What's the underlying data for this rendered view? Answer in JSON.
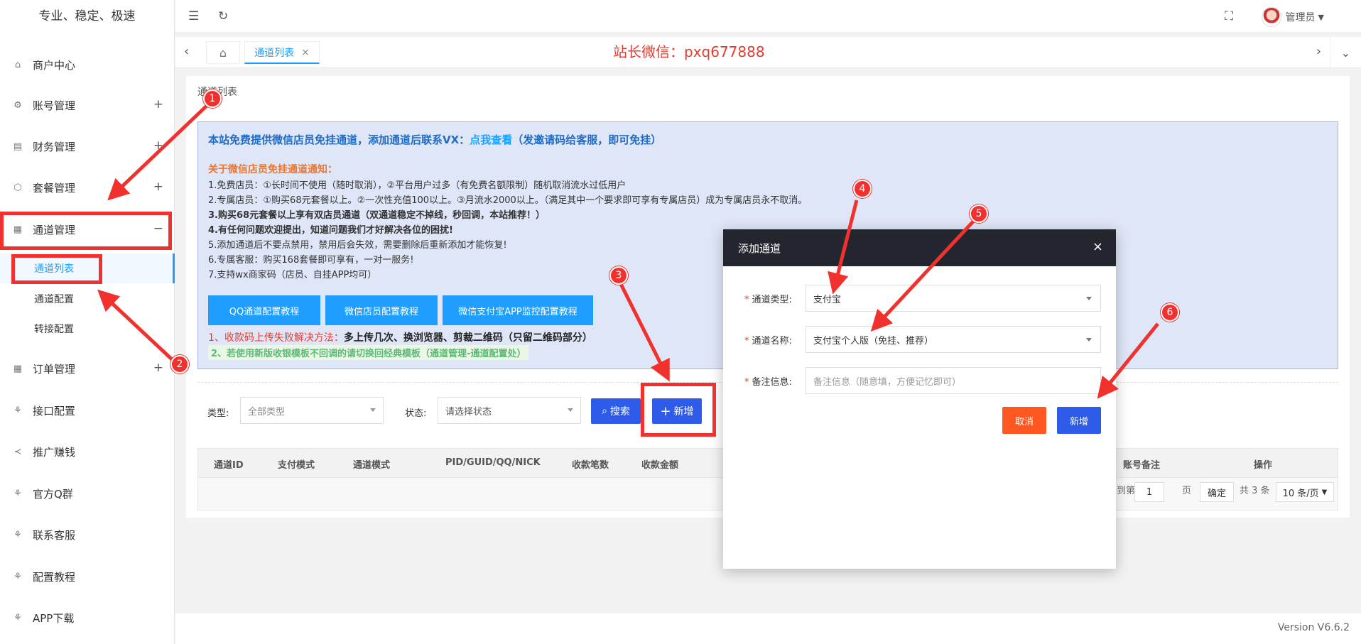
{
  "sidebar": {
    "brand": "专业、稳定、极速",
    "items": [
      {
        "label": "商户中心",
        "icon": "home-icon",
        "plus": ""
      },
      {
        "label": "账号管理",
        "icon": "gear-icon",
        "plus": "+"
      },
      {
        "label": "财务管理",
        "icon": "ledger-icon",
        "plus": "+"
      },
      {
        "label": "套餐管理",
        "icon": "package-icon",
        "plus": "+"
      },
      {
        "label": "通道管理",
        "icon": "apps-icon",
        "plus": "−"
      },
      {
        "label": "订单管理",
        "icon": "apps-icon",
        "plus": "+"
      },
      {
        "label": "接口配置",
        "icon": "plug-icon",
        "plus": ""
      },
      {
        "label": "推广赚钱",
        "icon": "share-icon",
        "plus": ""
      },
      {
        "label": "官方Q群",
        "icon": "plug-icon",
        "plus": ""
      },
      {
        "label": "联系客服",
        "icon": "plug-icon",
        "plus": ""
      },
      {
        "label": "配置教程",
        "icon": "plug-icon",
        "plus": ""
      },
      {
        "label": "APP下载",
        "icon": "plug-icon",
        "plus": ""
      }
    ],
    "subitems": [
      "通道列表",
      "通道配置",
      "转接配置"
    ]
  },
  "topbar": {
    "user": "管理员"
  },
  "tabs": {
    "active": "通道列表",
    "close": "×",
    "wechat_note": "站长微信：pxq677888"
  },
  "card": {
    "title": "通道列表",
    "notice": {
      "head": "本站免费提供微信店员免挂通道，添加通道后联系VX：",
      "head_link": "点我查看",
      "head_tail": "（发邀请码给客服，即可免挂）",
      "sub": "关于微信店员免挂通道通知：",
      "lines": [
        "1.免费店员：①长时间不使用（随时取消），②平台用户过多（有免费名额限制）随机取消流水过低用户",
        "2.专属店员：①购买68元套餐以上。②一次性充值100以上。③月流水2000以上。（满足其中一个要求即可享有专属店员）成为专属店员永不取消。",
        "3.购买68元套餐以上享有双店员通道（双通道稳定不掉线，秒回调，本站推荐！）",
        "4.有任何问题欢迎提出，知道问题我们才好解决各位的困扰!",
        "5.添加通道后不要点禁用，禁用后会失效，需要删除后重新添加才能恢复!",
        "6.专属客服：购买168套餐即可享有，一对一服务!",
        "7.支持wx商家码（店员、自挂APP均可）"
      ],
      "buttons": [
        "QQ通道配置教程",
        "微信店员配置教程",
        "微信支付宝APP监控配置教程"
      ],
      "red_tip": "1、收款码上传失败解决方法：",
      "red_tip_bold": "多上传几次、换浏览器、剪裁二维码（只留二维码部分）",
      "green_tip": "2、若使用新版收银模板不回调的请切换回经典模板（通道管理-通道配置处）"
    },
    "filters": {
      "type_label": "类型:",
      "type_value": "全部类型",
      "status_label": "状态:",
      "status_value": "请选择状态",
      "search": "搜索",
      "add": "新增"
    },
    "table_headers": [
      "通道ID",
      "支付模式",
      "通道模式",
      "PID/GUID/QQ/NICK",
      "收款笔数",
      "收款金额",
      "账号备注",
      "操作"
    ],
    "pager": {
      "goto": "到第",
      "page": "1",
      "page_unit": "页",
      "confirm": "确定",
      "total": "共 3 条",
      "per_page": "10 条/页"
    }
  },
  "modal": {
    "title": "添加通道",
    "close": "×",
    "fields": [
      {
        "label": "通道类型:",
        "value": "支付宝"
      },
      {
        "label": "通道名称:",
        "value": "支付宝个人版（免挂、推荐）"
      },
      {
        "label": "备注信息:",
        "placeholder": "备注信息（随意填，方便记忆即可）"
      }
    ],
    "cancel": "取消",
    "submit": "新增"
  },
  "badges": [
    "1",
    "2",
    "3",
    "4",
    "5",
    "6"
  ],
  "footer": {
    "version": "Version V6.6.2"
  },
  "colors": {
    "accent": "#1e9fff",
    "annotation": "#f0312e",
    "cancel": "#ff5722",
    "primary": "#2e5be8"
  }
}
